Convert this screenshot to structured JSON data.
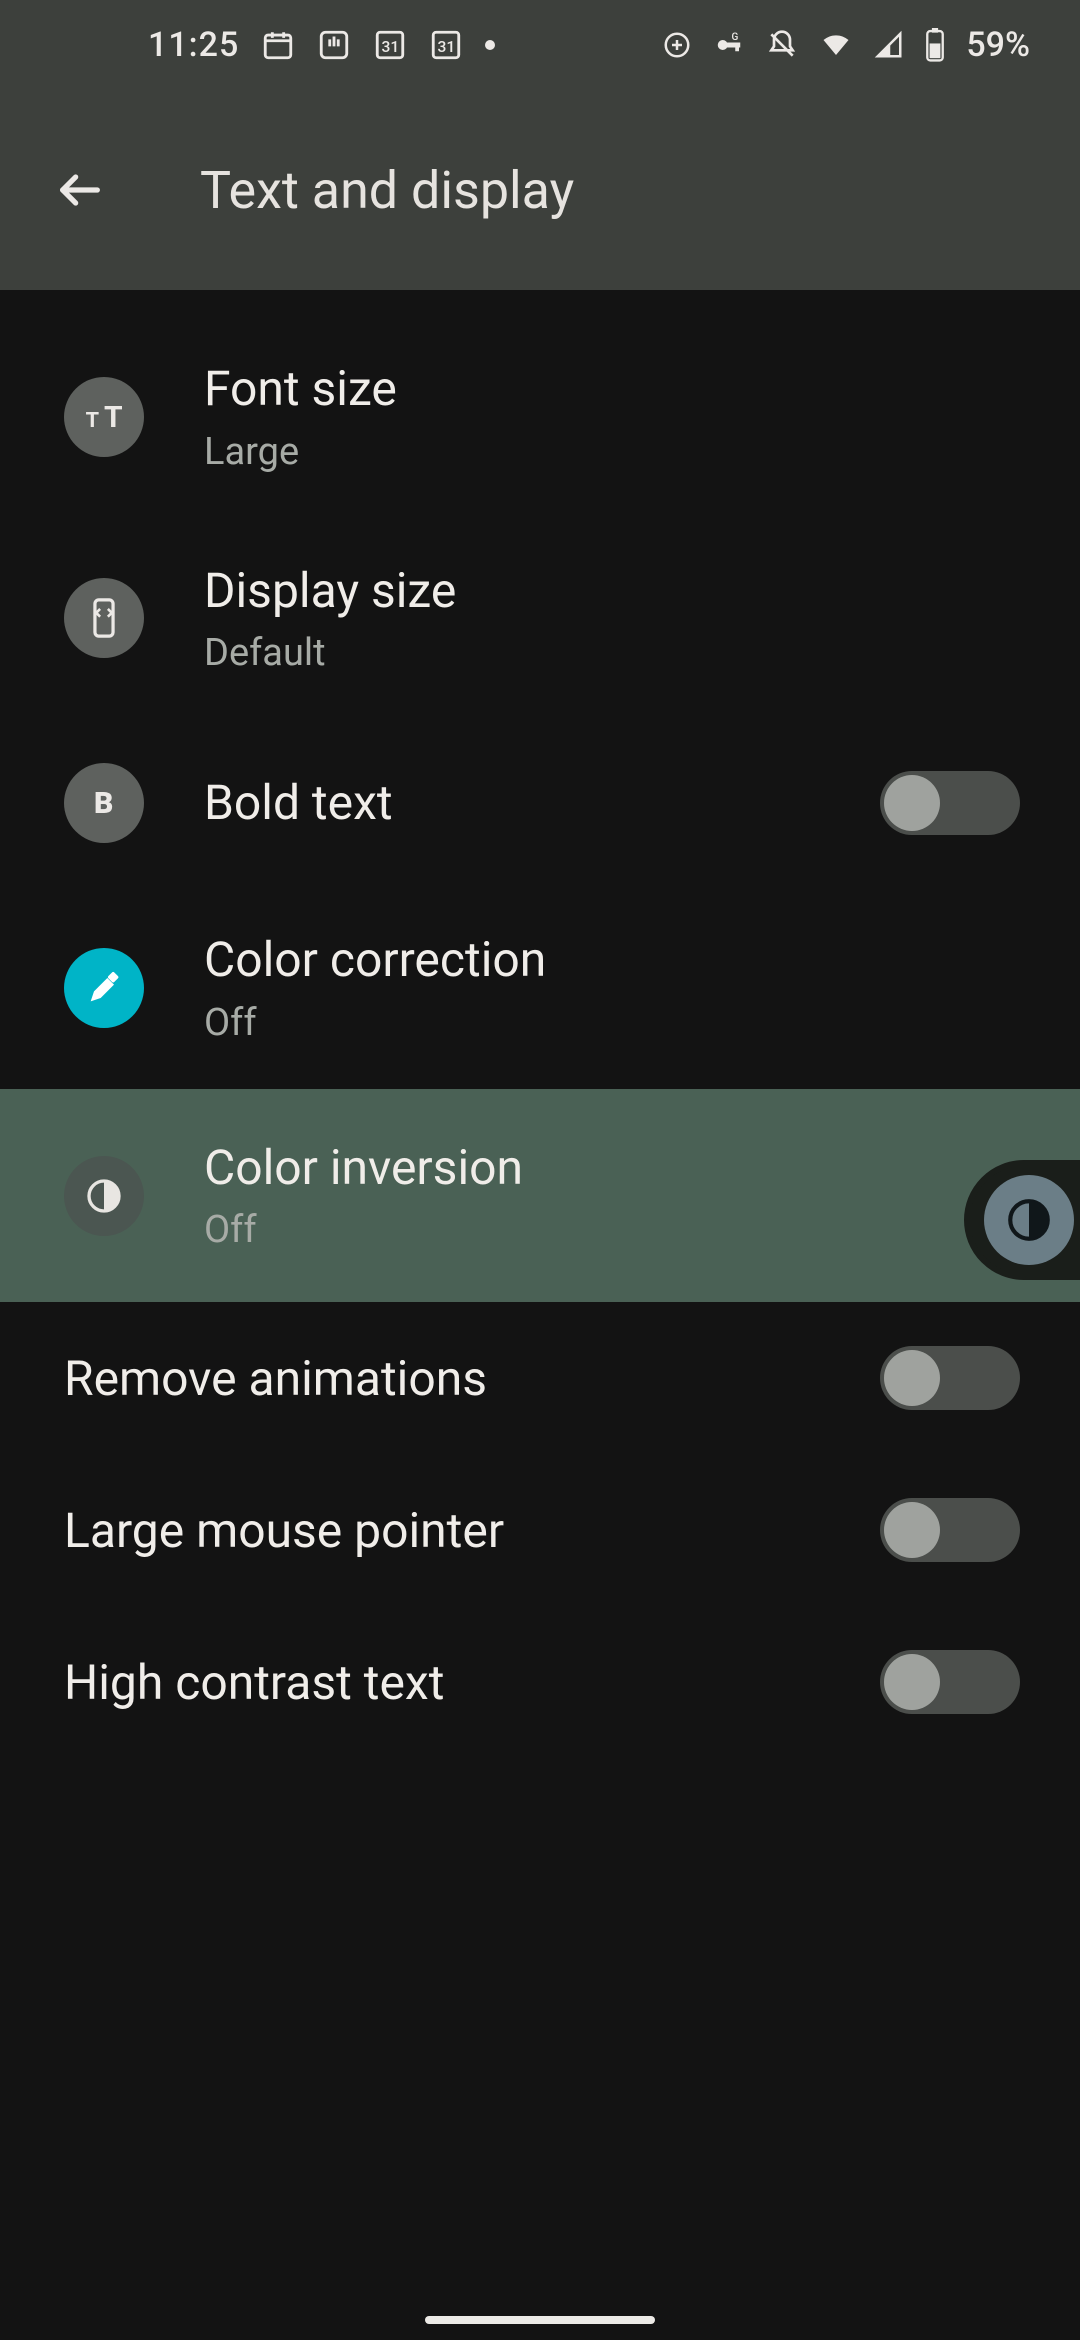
{
  "status": {
    "time": "11:25",
    "battery": "59%"
  },
  "appbar": {
    "title": "Text and display"
  },
  "rows": {
    "font_size": {
      "title": "Font size",
      "sub": "Large"
    },
    "display_size": {
      "title": "Display size",
      "sub": "Default"
    },
    "bold_text": {
      "title": "Bold text"
    },
    "color_correction": {
      "title": "Color correction",
      "sub": "Off"
    },
    "color_inversion": {
      "title": "Color inversion",
      "sub": "Off"
    },
    "remove_animations": {
      "title": "Remove animations"
    },
    "large_pointer": {
      "title": "Large mouse pointer"
    },
    "high_contrast": {
      "title": "High contrast text"
    }
  }
}
